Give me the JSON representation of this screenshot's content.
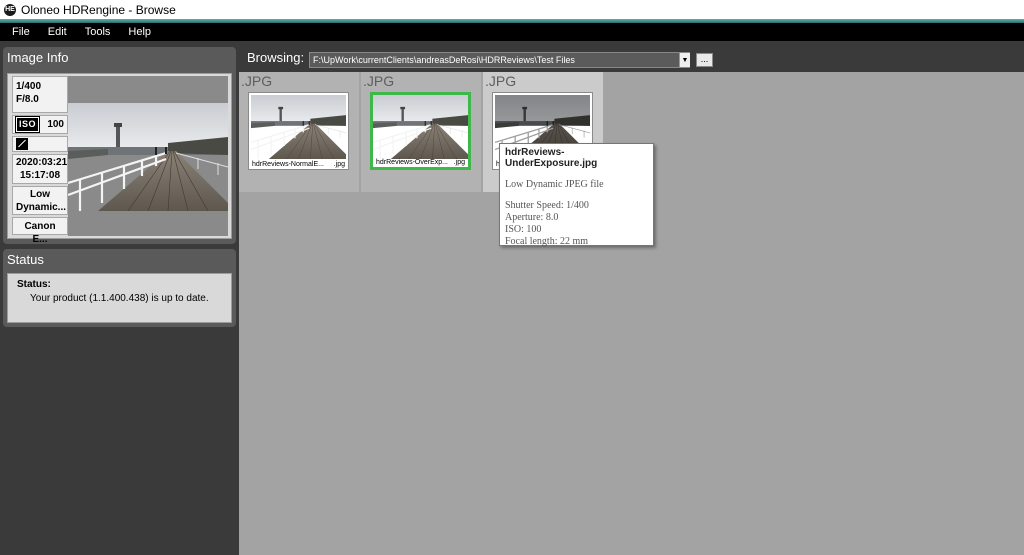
{
  "window": {
    "title": "Oloneo HDRengine - Browse",
    "icon_text": "HE"
  },
  "menu": [
    "File",
    "Edit",
    "Tools",
    "Help"
  ],
  "image_info": {
    "title": "Image Info",
    "shutter": "1/400",
    "aperture": "F/8.0",
    "iso_label": "ISO",
    "iso": "100",
    "date": "2020:03:21",
    "time": "15:17:08",
    "dynamic_line1": "Low",
    "dynamic_line2": "Dynamic...",
    "camera": "Canon E..."
  },
  "status": {
    "title": "Status",
    "label": "Status:",
    "text": "Your product (1.1.400.438) is up to date."
  },
  "browse": {
    "label": "Browsing:",
    "path": "F:\\UpWork\\currentClients\\andreasDeRosi\\HDRReviews\\Test Files",
    "more_button": "..."
  },
  "thumbnails": [
    {
      "ext": ".JPG",
      "name": "hdrReviews-NormalE...",
      "suffix": ".jpg"
    },
    {
      "ext": ".JPG",
      "name": "hdrReviews-OverExp...",
      "suffix": ".jpg"
    },
    {
      "ext": ".JPG",
      "name": "h",
      "suffix": ""
    }
  ],
  "tooltip": {
    "title": "hdrReviews-UnderExposure.jpg",
    "type": "Low Dynamic JPEG file",
    "shutter": "Shutter Speed: 1/400",
    "aperture": "Aperture: 8.0",
    "iso": "ISO: 100",
    "focal": "Focal length: 22 mm"
  },
  "colors": {
    "selected_border": "#3eb84a",
    "background": "#a3a3a3",
    "panel": "#5a5a5a"
  }
}
